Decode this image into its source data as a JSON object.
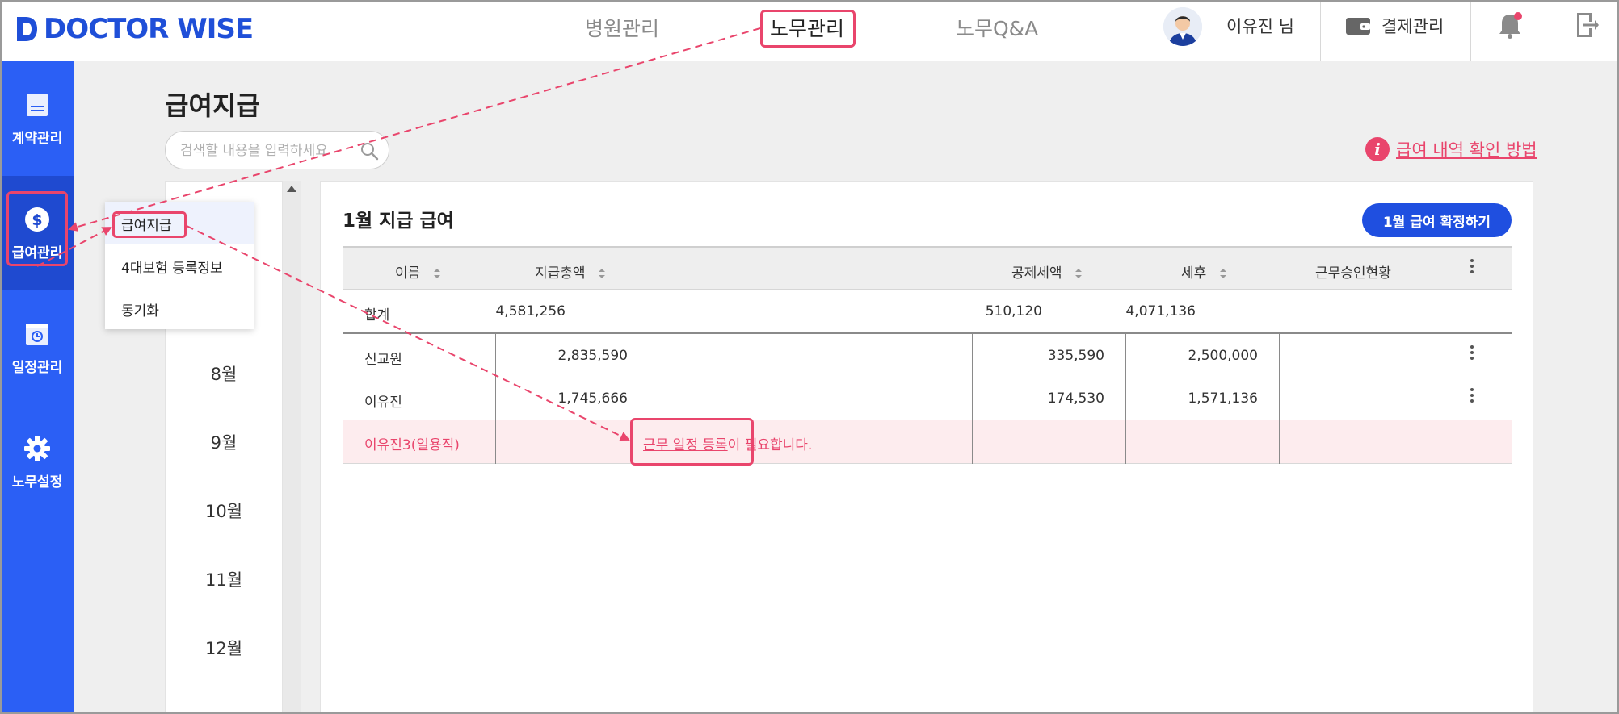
{
  "brand": {
    "name": "DOCTOR WISE",
    "color": "#1f4fd8"
  },
  "nav": [
    {
      "label": "병원관리",
      "active": false
    },
    {
      "label": "노무관리",
      "active": true
    },
    {
      "label": "노무Q&A",
      "active": false
    }
  ],
  "user": {
    "name": "이유진 님"
  },
  "header": {
    "payment_label": "결제관리",
    "notification_dot_color": "#e9456c"
  },
  "sidebar": {
    "items": [
      {
        "label": "계약관리",
        "icon": "document-icon",
        "active": false
      },
      {
        "label": "급여관리",
        "icon": "dollar-coin-icon",
        "active": true
      },
      {
        "label": "일정관리",
        "icon": "calendar-clock-icon",
        "active": false
      },
      {
        "label": "노무설정",
        "icon": "gear-icon",
        "active": false
      }
    ]
  },
  "submenu": {
    "items": [
      {
        "label": "급여지급",
        "active": true
      },
      {
        "label": "4대보험 등록정보",
        "active": false
      },
      {
        "label": "동기화",
        "active": false
      }
    ]
  },
  "page": {
    "title": "급여지급",
    "search_placeholder": "검색할 내용을 입력하세요",
    "help_link": "급여 내역 확인 방법"
  },
  "months": [
    "8월",
    "9월",
    "10월",
    "11월",
    "12월"
  ],
  "salary": {
    "title": "1월 지급 급여",
    "confirm_button": "1월 급여 확정하기",
    "columns": [
      "이름",
      "지급총액",
      "공제세액",
      "세후",
      "근무승인현황"
    ],
    "total": {
      "name": "합계",
      "gross": "4,581,256",
      "tax": "510,120",
      "net": "4,071,136"
    },
    "rows": [
      {
        "name": "신교원",
        "gross": "2,835,590",
        "tax": "335,590",
        "net": "2,500,000"
      },
      {
        "name": "이유진",
        "gross": "1,745,666",
        "tax": "174,530",
        "net": "1,571,136"
      }
    ],
    "warning_row": {
      "name": "이유진3(일용직)",
      "link_text": "근무 일정 등록",
      "message_suffix": "이 필요합니다."
    }
  },
  "colors": {
    "accent": "#2b5ff5",
    "sidebar_active": "#1f4ad0",
    "highlight": "#e9456c",
    "button": "#1f4fe0",
    "warning_bg": "#fdecee"
  }
}
